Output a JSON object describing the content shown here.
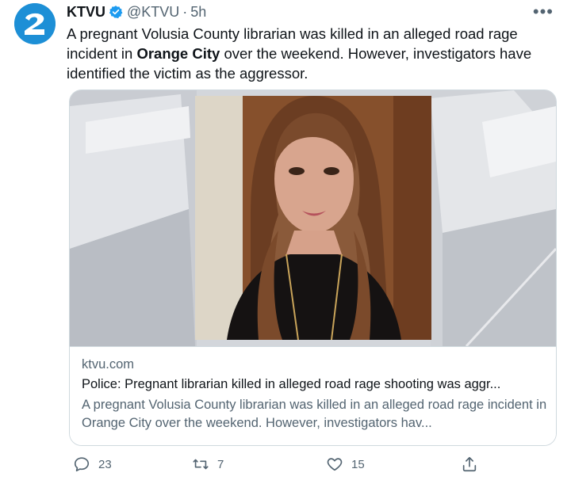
{
  "tweet": {
    "author_name": "KTVU",
    "handle": "@KTVU",
    "separator": "·",
    "time": "5h",
    "text_before": "A pregnant Volusia County librarian was killed in an alleged road rage incident in ",
    "text_bold": "Orange City",
    "text_after": " over the weekend. However, investigators have identified the victim as the aggressor.",
    "more_icon": "•••"
  },
  "card": {
    "domain": "ktvu.com",
    "title": "Police: Pregnant librarian killed in alleged road rage shooting was aggr...",
    "description": "A pregnant Volusia County librarian was killed in an alleged road rage incident in Orange City over the weekend. However, investigators hav..."
  },
  "actions": {
    "replies": "23",
    "retweets": "7",
    "likes": "15"
  },
  "icons": {
    "avatar": "ktvu-logo-icon",
    "verified": "verified-badge-icon",
    "reply": "reply-icon",
    "retweet": "retweet-icon",
    "like": "heart-icon",
    "share": "share-icon"
  },
  "colors": {
    "brand_blue": "#1d8fd6",
    "verified": "#1d9bf0",
    "text": "#0f1419",
    "secondary": "#536471",
    "border": "#cfd9de"
  }
}
